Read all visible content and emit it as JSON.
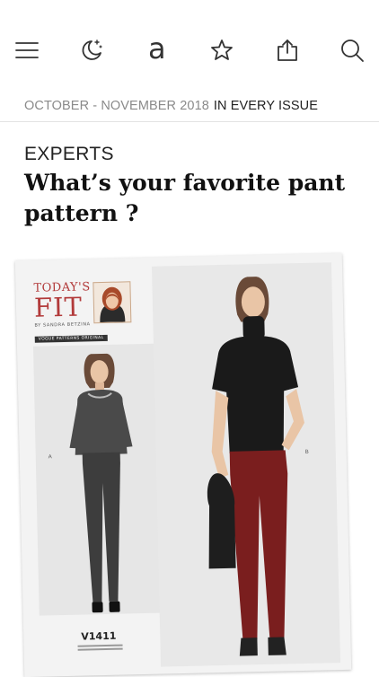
{
  "toolbar": {
    "icons": [
      "menu-icon",
      "night-mode-icon",
      "text-size-icon",
      "bookmark-star-icon",
      "share-icon",
      "search-icon"
    ],
    "text_size_glyph": "a"
  },
  "issue": {
    "date": "OCTOBER - NOVEMBER 2018",
    "section": "IN EVERY ISSUE"
  },
  "article": {
    "kicker": "EXPERTS",
    "headline": "What’s your favorite pant pattern ?"
  },
  "figure": {
    "brand_line1": "TODAY'S",
    "brand_line2": "FIT",
    "brand_line3": "BY SANDRA BETZINA",
    "brand_line4": "VOGUE PATTERNS ORIGINAL",
    "view_a": "A",
    "view_b": "B",
    "pattern_code": "V1411"
  },
  "colors": {
    "accent_red": "#b23a3a",
    "top_left": "#4a4a4a",
    "pants_left": "#3d3d3d",
    "top_right": "#1a1a1a",
    "pants_right": "#7a1e1e"
  }
}
